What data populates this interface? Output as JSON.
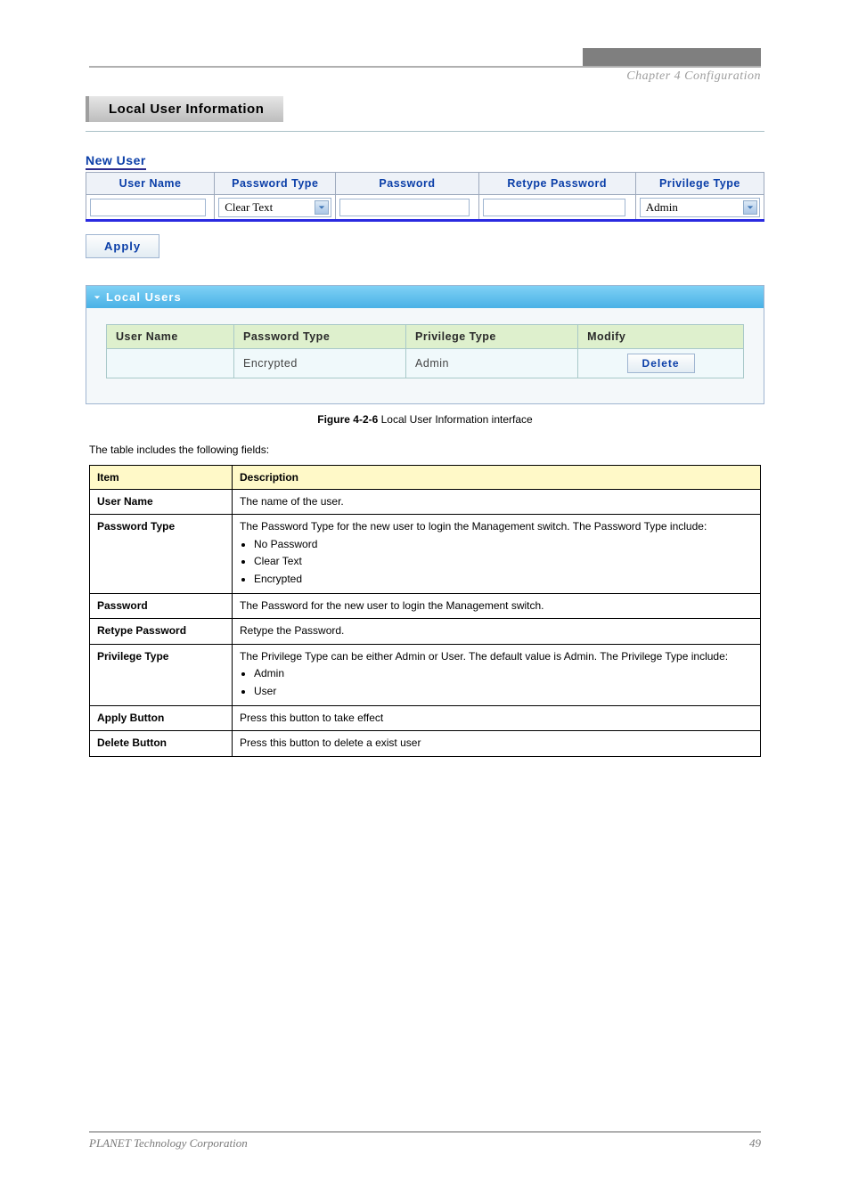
{
  "chapter": "Chapter 4 Configuration",
  "screenshot": {
    "panelTitle": "Local User Information",
    "newUser": {
      "title": "New User",
      "headers": [
        "User Name",
        "Password Type",
        "Password",
        "Retype Password",
        "Privilege Type"
      ],
      "passwordTypeSelected": "Clear Text",
      "privilegeTypeSelected": "Admin"
    },
    "applyLabel": "Apply",
    "localUsers": {
      "title": "Local Users",
      "headers": [
        "User Name",
        "Password Type",
        "Privilege Type",
        "Modify"
      ],
      "rows": [
        {
          "userName": "",
          "passwordType": "Encrypted",
          "privilegeType": "Admin",
          "action": "Delete"
        }
      ]
    }
  },
  "caption": {
    "figno": "Figure 4-2-6",
    "text": "Local User Information interface"
  },
  "body": "The table includes the following fields:",
  "desc": {
    "headers": [
      "Item",
      "Description"
    ],
    "rows": [
      {
        "item": "User Name",
        "desc": "The name of the user."
      },
      {
        "item": "Password Type",
        "desc": "The Password Type for the new user to login the Management switch. The Password Type include:",
        "bullets": [
          "No Password",
          "Clear Text",
          "Encrypted"
        ]
      },
      {
        "item": "Password",
        "desc": "The Password for the new user to login the Management switch."
      },
      {
        "item": "Retype Password",
        "desc": "Retype the Password."
      },
      {
        "item": "Privilege Type",
        "desc": "The Privilege Type can be either Admin or User. The default value is Admin. The Privilege Type include:",
        "bullets": [
          "Admin",
          "User"
        ]
      },
      {
        "item": "Apply Button",
        "desc": "Press this button to take effect"
      },
      {
        "item": "Delete Button",
        "desc": "Press this button to delete a exist user"
      }
    ]
  },
  "footer": {
    "left": "PLANET Technology Corporation",
    "right": "49"
  }
}
